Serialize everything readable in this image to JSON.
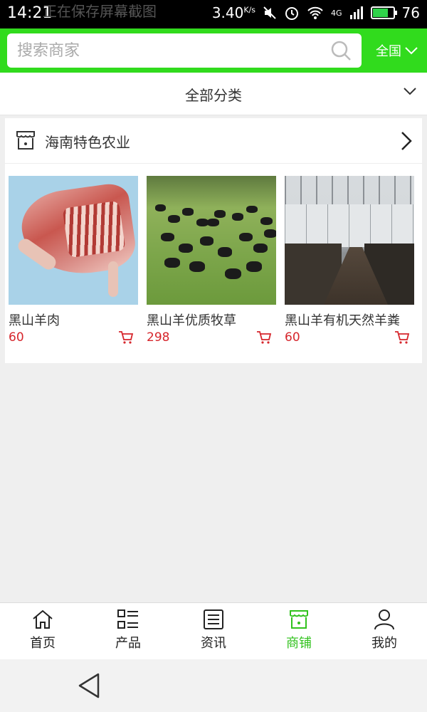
{
  "status_bar": {
    "time": "14:21",
    "notification": "正在保存屏幕截图",
    "speed": "3.40",
    "speed_unit": "K/s",
    "network": "4G",
    "battery": "76",
    "battery_level": 0.76
  },
  "search": {
    "placeholder": "搜索商家",
    "region_label": "全国"
  },
  "category_bar": {
    "label": "全部分类"
  },
  "shop": {
    "name": "海南特色农业",
    "products": [
      {
        "name": "黑山羊肉",
        "price": "60",
        "image": "goat-meat"
      },
      {
        "name": "黑山羊优质牧草",
        "price": "298",
        "image": "goats-grazing"
      },
      {
        "name": "黑山羊有机天然羊粪",
        "price": "60",
        "image": "manure-barn"
      }
    ]
  },
  "tabbar": {
    "items": [
      {
        "label": "首页",
        "icon": "home-icon",
        "active": false
      },
      {
        "label": "产品",
        "icon": "list-icon",
        "active": false
      },
      {
        "label": "资讯",
        "icon": "news-icon",
        "active": false
      },
      {
        "label": "商铺",
        "icon": "store-icon",
        "active": true
      },
      {
        "label": "我的",
        "icon": "user-icon",
        "active": false
      }
    ]
  },
  "colors": {
    "brand": "#31db1d",
    "active_tab": "#31c21d",
    "price": "#d6262c"
  }
}
